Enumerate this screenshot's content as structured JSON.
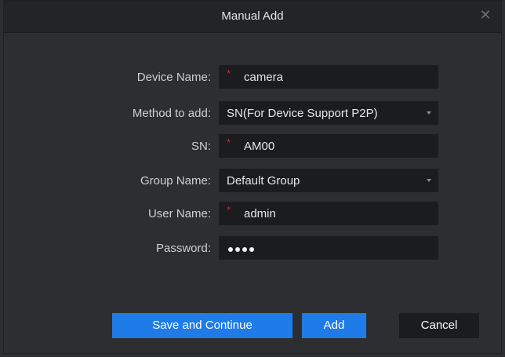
{
  "dialog": {
    "title": "Manual Add",
    "close_glyph": "✕"
  },
  "form": {
    "device_name": {
      "label": "Device Name:",
      "value": "camera",
      "required": true
    },
    "method": {
      "label": "Method to add:",
      "value": "SN(For Device Support P2P)"
    },
    "sn": {
      "label": "SN:",
      "value": "AM00",
      "required": true
    },
    "group": {
      "label": "Group Name:",
      "value": "Default Group"
    },
    "user_name": {
      "label": "User Name:",
      "value": "admin",
      "required": true
    },
    "password": {
      "label": "Password:",
      "masked_length": 4
    },
    "required_mark": "*"
  },
  "buttons": {
    "save_continue": "Save and Continue",
    "add": "Add",
    "cancel": "Cancel"
  },
  "colors": {
    "accent": "#1e7be8",
    "required": "#e0242a",
    "background": "#2c2e31",
    "field": "#1b1c1e"
  }
}
